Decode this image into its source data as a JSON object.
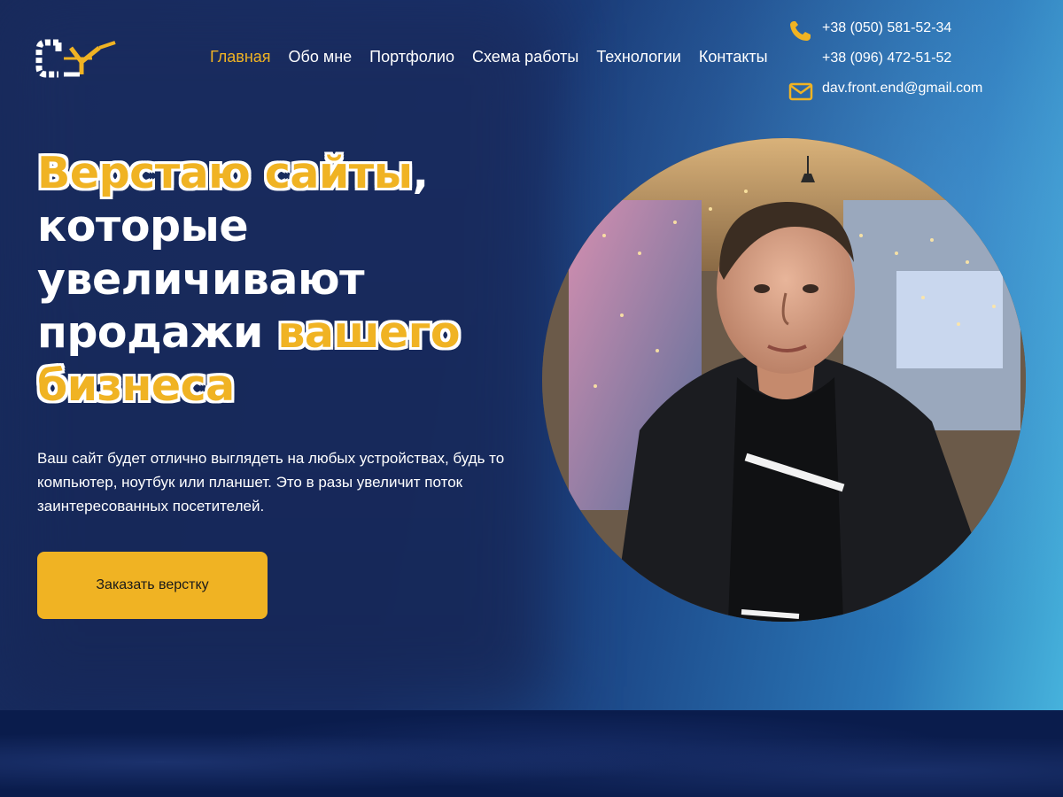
{
  "nav": {
    "items": [
      {
        "label": "Главная",
        "active": true
      },
      {
        "label": "Обо мне",
        "active": false
      },
      {
        "label": "Портфолио",
        "active": false
      },
      {
        "label": "Схема работы",
        "active": false
      },
      {
        "label": "Технологии",
        "active": false
      },
      {
        "label": "Контакты",
        "active": false
      }
    ]
  },
  "contacts": {
    "phone_1": "+38 (050) 581-52-34",
    "phone_2": "+38 (096) 472-51-52",
    "email": "dav.front.end@gmail.com"
  },
  "hero": {
    "headline_part_1": "Верстаю сайты",
    "headline_part_2": ",",
    "headline_part_3": "которые",
    "headline_part_4": "увеличивают",
    "headline_part_5": "продажи",
    "headline_part_6": "вашего",
    "headline_part_7": "бизнеса",
    "description": "Ваш сайт будет отлично выглядеть на любых устройствах, будь то компьютер, ноутбук или планшет. Это в разы увеличит поток заинтересованных посетителей.",
    "cta_label": "Заказать верстку"
  },
  "colors": {
    "accent": "#f0b323",
    "hero_dark": "#17295a",
    "hero_light": "#46b2dc",
    "text": "#ffffff"
  },
  "icons": {
    "logo": "logo-icon",
    "phone": "phone-icon",
    "email": "email-icon"
  }
}
